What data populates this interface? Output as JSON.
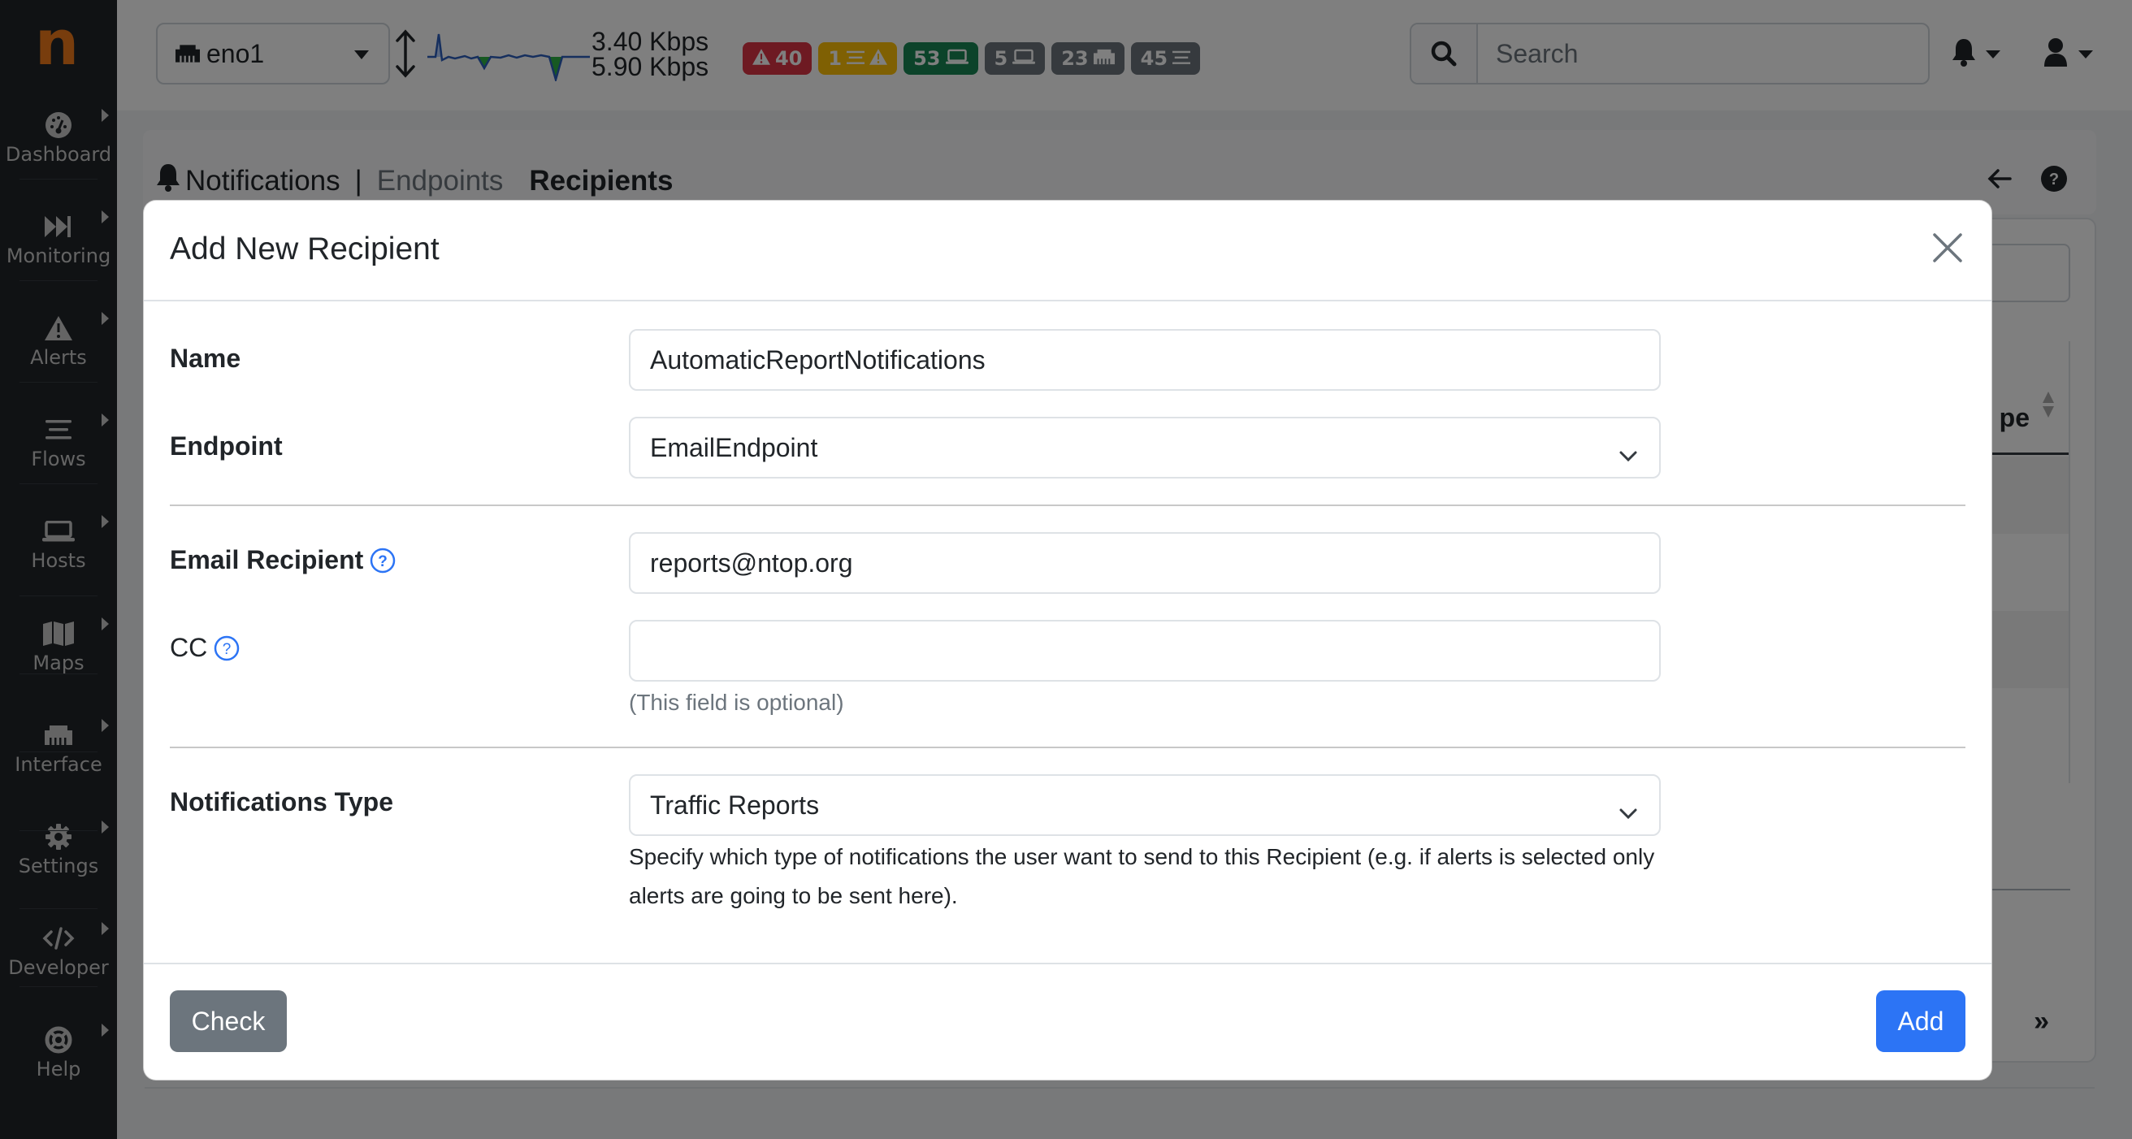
{
  "app": {
    "logo_letter": "n",
    "brand_color": "#f07a1a"
  },
  "sidebar": {
    "items": [
      {
        "label": "Dashboard",
        "icon": "gauge-icon"
      },
      {
        "label": "Monitoring",
        "icon": "fast-forward-icon"
      },
      {
        "label": "Alerts",
        "icon": "warning-icon"
      },
      {
        "label": "Flows",
        "icon": "bars-icon"
      },
      {
        "label": "Hosts",
        "icon": "laptop-icon"
      },
      {
        "label": "Maps",
        "icon": "map-icon"
      },
      {
        "label": "Interface",
        "icon": "ethernet-icon"
      },
      {
        "label": "Settings",
        "icon": "gear-icon"
      },
      {
        "label": "Developer",
        "icon": "code-icon"
      },
      {
        "label": "Help",
        "icon": "life-ring-icon"
      }
    ]
  },
  "topbar": {
    "interface": {
      "selected": "eno1",
      "icon": "ethernet-icon"
    },
    "throughput": {
      "upload": "3.40 Kbps",
      "download": "5.90 Kbps"
    },
    "badges": [
      {
        "kind": "alerts",
        "value": "40",
        "icon": "warning-icon",
        "color": "#dc3545",
        "position": "before"
      },
      {
        "kind": "flow-alerts",
        "value": "1",
        "icon": "bars-warning-icon",
        "color": "#ffc107",
        "position": "after"
      },
      {
        "kind": "local-hosts",
        "value": "53",
        "icon": "laptop-icon",
        "color": "#198754",
        "position": "after"
      },
      {
        "kind": "remote-hosts",
        "value": "5",
        "icon": "laptop-icon",
        "color": "#6c757d",
        "position": "after"
      },
      {
        "kind": "devices",
        "value": "23",
        "icon": "ethernet-icon",
        "color": "#6c757d",
        "position": "after"
      },
      {
        "kind": "flows",
        "value": "45",
        "icon": "bars-icon",
        "color": "#6c757d",
        "position": "after"
      }
    ],
    "search": {
      "placeholder": "Search",
      "value": ""
    }
  },
  "page": {
    "breadcrumb": {
      "section": "Notifications",
      "separator": "|",
      "tabs": [
        {
          "label": "Endpoints",
          "active": false
        },
        {
          "label": "Recipients",
          "active": true
        }
      ]
    },
    "background_table": {
      "visible_column_fragment": "pe",
      "pager_next": "»"
    }
  },
  "modal": {
    "title": "Add New Recipient",
    "fields": {
      "name": {
        "label": "Name",
        "value": "AutomaticReportNotifications"
      },
      "endpoint": {
        "label": "Endpoint",
        "selected": "EmailEndpoint"
      },
      "email": {
        "label": "Email Recipient",
        "value": "reports@ntop.org"
      },
      "cc": {
        "label": "CC",
        "value": "",
        "hint": "(This field is optional)"
      },
      "notifications_type": {
        "label": "Notifications Type",
        "selected": "Traffic Reports",
        "help": "Specify which type of notifications the user want to send to this Recipient (e.g. if alerts is selected only alerts are going to be sent here)."
      }
    },
    "buttons": {
      "check": "Check",
      "add": "Add"
    }
  }
}
